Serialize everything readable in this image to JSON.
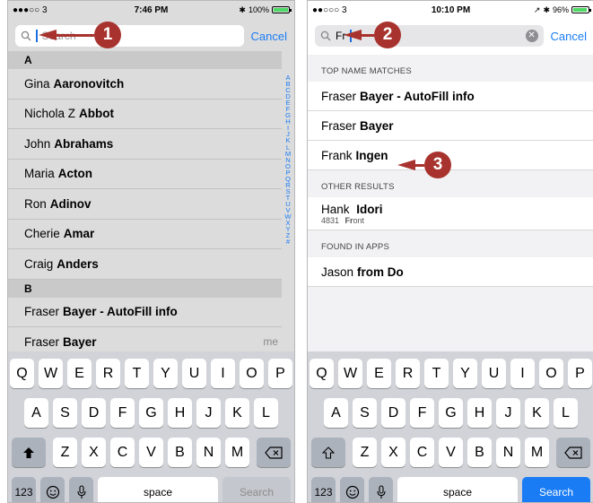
{
  "left": {
    "status": {
      "signal": "●●●○○ 3",
      "time": "7:46 PM",
      "battery": "100%",
      "battery_level": 1.0
    },
    "search": {
      "placeholder": "Search",
      "cancel": "Cancel"
    },
    "sections": [
      {
        "letter": "A",
        "contacts": [
          {
            "first": "Gina",
            "last": "Aaronovitch"
          },
          {
            "first": "Nichola Z",
            "last": "Abbot"
          },
          {
            "first": "John",
            "last": "Abrahams"
          },
          {
            "first": "Maria",
            "last": "Acton"
          },
          {
            "first": "Ron",
            "last": "Adinov"
          },
          {
            "first": "Cherie",
            "last": "Amar"
          },
          {
            "first": "Craig",
            "last": "Anders"
          }
        ]
      },
      {
        "letter": "B",
        "contacts": [
          {
            "first": "Fraser",
            "last": "Bayer - AutoFill info"
          },
          {
            "first": "Fraser",
            "last": "Bayer",
            "tag": "me"
          }
        ]
      }
    ],
    "index_letters": "A B C D E F G H I J K L M N O P Q R S T U V W X Y Z #",
    "callout": "1"
  },
  "right": {
    "status": {
      "signal": "●●○○○ 3",
      "time": "10:10 PM",
      "battery": "96%",
      "battery_level": 0.96
    },
    "search": {
      "query": "Fr",
      "cancel": "Cancel"
    },
    "top_header": "TOP NAME MATCHES",
    "top": [
      {
        "first": "Fraser",
        "last": "Bayer - AutoFill info"
      },
      {
        "first": "Fraser",
        "last": "Bayer"
      },
      {
        "first": "Frank",
        "last": "Ingen"
      }
    ],
    "other_header": "OTHER RESULTS",
    "other": [
      {
        "first": "Hank",
        "last": "Idori",
        "sub_num": "4831",
        "sub_bold": "Fr",
        "sub_rest": "ont"
      }
    ],
    "apps_header": "FOUND IN APPS",
    "apps": [
      {
        "first": "Jason",
        "last": "from Do"
      }
    ],
    "callouts": [
      "2",
      "3"
    ]
  },
  "keyboard": {
    "row1": [
      "Q",
      "W",
      "E",
      "R",
      "T",
      "Y",
      "U",
      "I",
      "O",
      "P"
    ],
    "row2": [
      "A",
      "S",
      "D",
      "F",
      "G",
      "H",
      "J",
      "K",
      "L"
    ],
    "row3": [
      "Z",
      "X",
      "C",
      "V",
      "B",
      "N",
      "M"
    ],
    "numbers": "123",
    "space": "space",
    "search": "Search",
    "icons": [
      "shift-icon",
      "backspace-icon",
      "emoji-icon",
      "mic-icon"
    ]
  }
}
